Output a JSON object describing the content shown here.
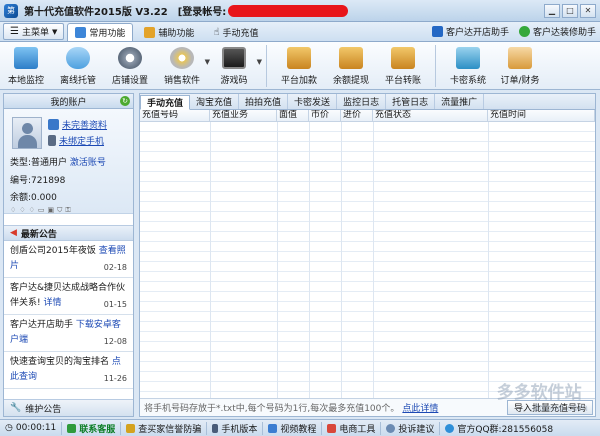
{
  "titlebar": {
    "title": "第十代充值软件2015版 V3.22",
    "login_label": "[登录帐号:",
    "account": ""
  },
  "topbar": {
    "main_menu": "主菜单",
    "tabs": [
      {
        "label": "常用功能"
      },
      {
        "label": "辅助功能"
      },
      {
        "label": "手动充值"
      }
    ],
    "links": [
      {
        "label": "客户达开店助手"
      },
      {
        "label": "客户达装修助手"
      }
    ]
  },
  "ribbon": {
    "buttons": [
      {
        "label": "本地监控"
      },
      {
        "label": "离线托管"
      },
      {
        "label": "店铺设置"
      },
      {
        "label": "销售软件"
      },
      {
        "label": "游戏码"
      },
      {
        "label": "平台加款"
      },
      {
        "label": "余额提现"
      },
      {
        "label": "平台转账"
      },
      {
        "label": "卡密系统"
      },
      {
        "label": "订单/财务"
      }
    ]
  },
  "account": {
    "header": "我的账户",
    "profile_link": "未完善资料",
    "phone_link": "未绑定手机",
    "type_label": "类型:普通用户",
    "activate_link": "激活账号",
    "id_label": "编号:721898",
    "balance_label": "余额:0.000"
  },
  "news": {
    "header": "最新公告",
    "items": [
      {
        "text": "创盾公司2015年夜饭",
        "link": "查看照片",
        "date": "02-18"
      },
      {
        "text": "客户达&捷贝达成战略合作伙伴关系!",
        "link": "详情",
        "date": "01-15"
      },
      {
        "text": "客户达开店助手",
        "link": "下载安卓客户端",
        "date": "12-08"
      },
      {
        "text": "快速查询宝贝的淘宝排名",
        "link": "点此查询",
        "date": "11-26"
      }
    ],
    "maintenance": "维护公告"
  },
  "content": {
    "subtabs": [
      "手动充值",
      "淘宝充值",
      "拍拍充值",
      "卡密发送",
      "监控日志",
      "托管日志",
      "流量推广"
    ],
    "active_subtab": 0,
    "columns": [
      "充值号码",
      "充值业务",
      "面值",
      "市价",
      "进价",
      "充值状态",
      "充值时间"
    ],
    "rows": [],
    "hint": "将手机号码存放于*.txt中,每个号码为1行,每次最多充值100个。",
    "hint_link": "点此详情",
    "import_button": "导入批量充值号码"
  },
  "statusbar": {
    "timer": "00:00:11",
    "items": [
      "联系客服",
      "查买家信誉防骗",
      "手机版本",
      "视频教程",
      "电商工具",
      "投诉建议"
    ],
    "official_qq": "官方QQ群:281556058"
  },
  "watermark": {
    "line1": "多多软件站",
    "line2": "ddooo.com"
  }
}
